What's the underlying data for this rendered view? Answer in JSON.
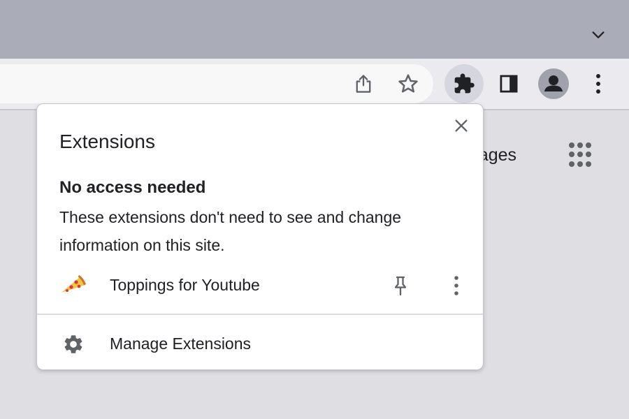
{
  "browser": {
    "icons": {
      "tabstrip_menu": "chevron-down-icon",
      "share": "share-icon",
      "bookmark": "star-outline-icon",
      "extensions": "puzzle-icon",
      "side_panel": "side-panel-icon",
      "profile": "avatar-icon",
      "menu": "more-vert-icon"
    },
    "colors": {
      "tabstrip": "#aaacb8",
      "toolbar": "#ebebef",
      "omnibox": "#f8f8f9",
      "active_button": "#d6d7de",
      "page": "#dedee3"
    }
  },
  "page": {
    "images_link_partial": "mages",
    "apps_icon": "apps-grid-icon"
  },
  "popup": {
    "title": "Extensions",
    "close_icon": "close-icon",
    "section_heading": "No access needed",
    "section_description": "These extensions don't need to see and change information on this site.",
    "extensions": [
      {
        "name": "Toppings for Youtube",
        "icon": "pizza-slice-icon",
        "pin_icon": "pin-icon",
        "more_icon": "more-vert-icon"
      }
    ],
    "manage_label": "Manage Extensions",
    "manage_icon": "gear-icon"
  }
}
